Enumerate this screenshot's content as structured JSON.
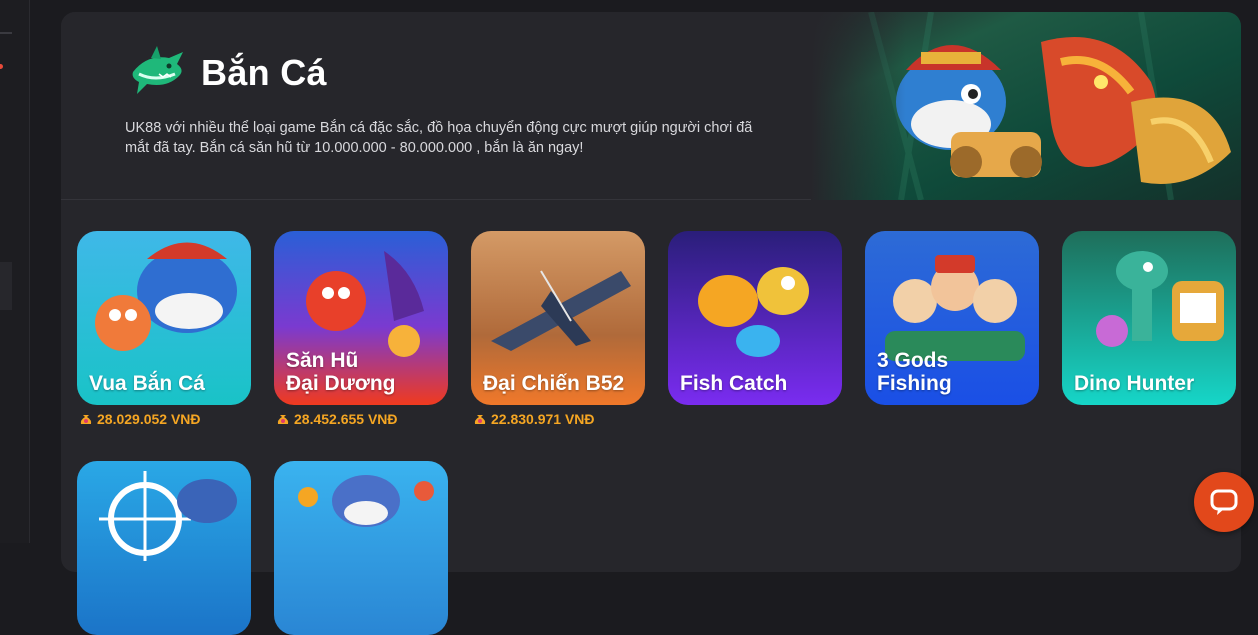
{
  "section": {
    "title": "Bắn Cá",
    "description": "UK88 với nhiều thể loại game Bắn cá đặc sắc, đồ họa chuyển động cực mượt giúp người chơi đã mắt đã tay. Bắn cá săn hũ từ 10.000.000 - 80.000.000 , bắn là ăn ngay!"
  },
  "games": [
    {
      "name": "Vua Bắn Cá",
      "jackpot": "28.029.052 VNĐ",
      "bg_top": "#3fb8e8",
      "bg_bottom": "#19c3c7"
    },
    {
      "name": "Săn Hũ\nĐại Dương",
      "jackpot": "28.452.655 VNĐ",
      "bg_top": "#2a5fd6",
      "bg_bottom": "#f03a1e"
    },
    {
      "name": "Đại Chiến B52",
      "jackpot": "22.830.971 VNĐ",
      "bg_top": "#c78a56",
      "bg_bottom": "#f0782a"
    },
    {
      "name": "Fish Catch",
      "jackpot": "",
      "bg_top": "#2a1e7a",
      "bg_bottom": "#7a2cf0"
    },
    {
      "name": "3 Gods\nFishing",
      "jackpot": "",
      "bg_top": "#2d6bd6",
      "bg_bottom": "#1a4fe6"
    },
    {
      "name": "Dino Hunter",
      "jackpot": "",
      "bg_top": "#1e6e5a",
      "bg_bottom": "#16d6c8"
    },
    {
      "name": "",
      "jackpot": "",
      "bg_top": "#2aa8e6",
      "bg_bottom": "#1b74c8"
    },
    {
      "name": "",
      "jackpot": "",
      "bg_top": "#3ab3ef",
      "bg_bottom": "#2a86d4"
    }
  ],
  "colors": {
    "accent": "#f5a623",
    "chat": "#e2481b",
    "panel": "#26262b"
  },
  "icons": {
    "jackpot": "money-bag-icon",
    "chat": "chat-bubble-icon",
    "logo": "shark-icon"
  }
}
